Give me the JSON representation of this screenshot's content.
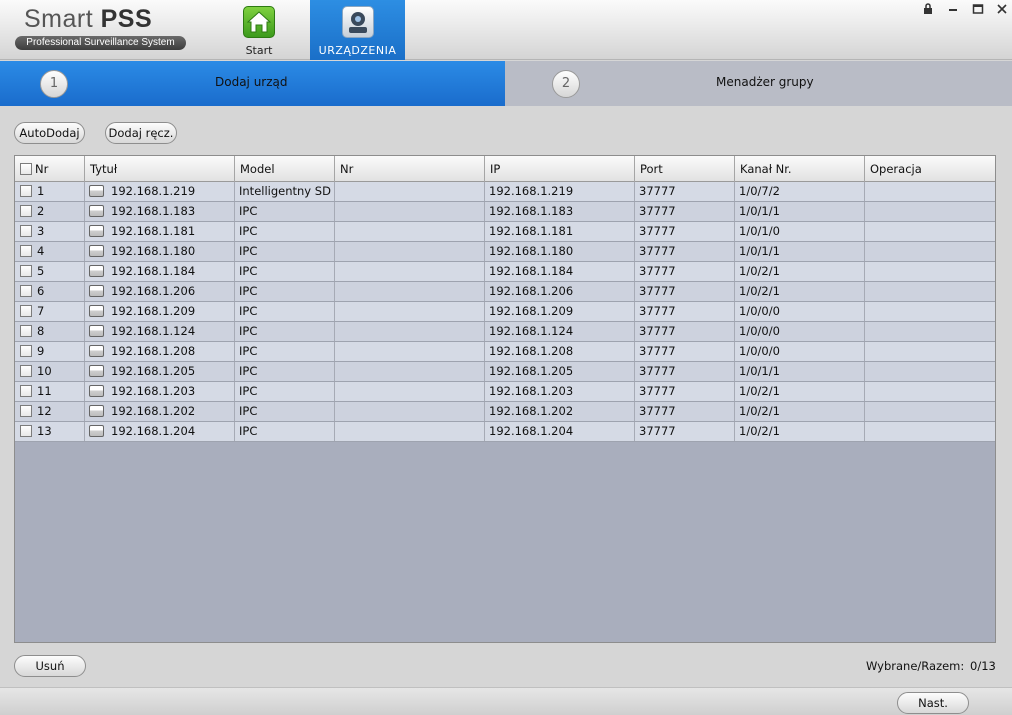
{
  "app": {
    "title_light": "Smart ",
    "title_bold": "PSS",
    "subtitle": "Professional Surveillance System"
  },
  "nav": {
    "start_label": "Start",
    "devices_label": "URZĄDZENIA",
    "start_icon": "home-icon",
    "devices_icon": "camera-device-icon"
  },
  "steps": [
    {
      "number": "1",
      "label": "Dodaj urząd"
    },
    {
      "number": "2",
      "label": "Menadżer grupy"
    }
  ],
  "toolbar": {
    "auto_add": "AutoDodaj",
    "manual_add": "Dodaj ręcz."
  },
  "table": {
    "columns": [
      "Nr",
      "Tytuł",
      "Model",
      "Nr",
      "IP",
      "Port",
      "Kanał Nr.",
      "Operacja"
    ],
    "rows": [
      {
        "nr": "1",
        "title": "192.168.1.219",
        "model": "Intelligentny SD",
        "sn": "",
        "ip": "192.168.1.219",
        "port": "37777",
        "channel": "1/0/7/2",
        "op": ""
      },
      {
        "nr": "2",
        "title": "192.168.1.183",
        "model": "IPC",
        "sn": "",
        "ip": "192.168.1.183",
        "port": "37777",
        "channel": "1/0/1/1",
        "op": ""
      },
      {
        "nr": "3",
        "title": "192.168.1.181",
        "model": "IPC",
        "sn": "",
        "ip": "192.168.1.181",
        "port": "37777",
        "channel": "1/0/1/0",
        "op": ""
      },
      {
        "nr": "4",
        "title": "192.168.1.180",
        "model": "IPC",
        "sn": "",
        "ip": "192.168.1.180",
        "port": "37777",
        "channel": "1/0/1/1",
        "op": ""
      },
      {
        "nr": "5",
        "title": "192.168.1.184",
        "model": "IPC",
        "sn": "",
        "ip": "192.168.1.184",
        "port": "37777",
        "channel": "1/0/2/1",
        "op": ""
      },
      {
        "nr": "6",
        "title": "192.168.1.206",
        "model": "IPC",
        "sn": "",
        "ip": "192.168.1.206",
        "port": "37777",
        "channel": "1/0/2/1",
        "op": ""
      },
      {
        "nr": "7",
        "title": "192.168.1.209",
        "model": "IPC",
        "sn": "",
        "ip": "192.168.1.209",
        "port": "37777",
        "channel": "1/0/0/0",
        "op": ""
      },
      {
        "nr": "8",
        "title": "192.168.1.124",
        "model": "IPC",
        "sn": "",
        "ip": "192.168.1.124",
        "port": "37777",
        "channel": "1/0/0/0",
        "op": ""
      },
      {
        "nr": "9",
        "title": "192.168.1.208",
        "model": "IPC",
        "sn": "",
        "ip": "192.168.1.208",
        "port": "37777",
        "channel": "1/0/0/0",
        "op": ""
      },
      {
        "nr": "10",
        "title": "192.168.1.205",
        "model": "IPC",
        "sn": "",
        "ip": "192.168.1.205",
        "port": "37777",
        "channel": "1/0/1/1",
        "op": ""
      },
      {
        "nr": "11",
        "title": "192.168.1.203",
        "model": "IPC",
        "sn": "",
        "ip": "192.168.1.203",
        "port": "37777",
        "channel": "1/0/2/1",
        "op": ""
      },
      {
        "nr": "12",
        "title": "192.168.1.202",
        "model": "IPC",
        "sn": "",
        "ip": "192.168.1.202",
        "port": "37777",
        "channel": "1/0/2/1",
        "op": ""
      },
      {
        "nr": "13",
        "title": "192.168.1.204",
        "model": "IPC",
        "sn": "",
        "ip": "192.168.1.204",
        "port": "37777",
        "channel": "1/0/2/1",
        "op": ""
      }
    ]
  },
  "footer": {
    "delete_label": "Usuń",
    "selected_label": "Wybrane/Razem:",
    "selected_value": "0/13",
    "next_label": "Nast."
  },
  "colors": {
    "accent": "#1a6fc8",
    "table_bg": "#a9aebd",
    "row_bg": "#d5dae5"
  }
}
